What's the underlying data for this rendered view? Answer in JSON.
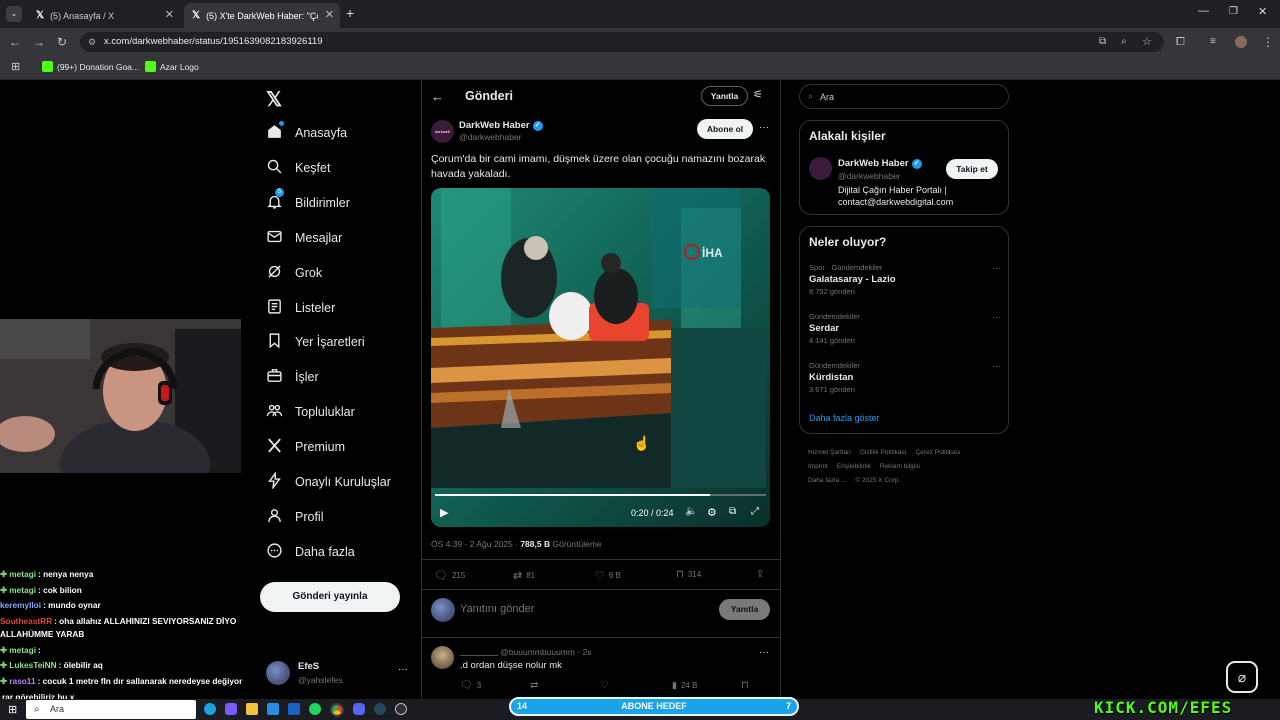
{
  "browser": {
    "tabs": [
      {
        "label": "(5) Anasayfa / X"
      },
      {
        "label": "(5) X'te DarkWeb Haber: \"Çorum"
      }
    ],
    "url": "x.com/darkwebhaber/status/1951639082183926119",
    "bookmarks": [
      {
        "label": "(99+) Donation Goa...",
        "color": "#53fc18"
      },
      {
        "label": "Azar Logo",
        "color": "#53fc18"
      }
    ]
  },
  "chat": [
    {
      "user": "metagi",
      "text": ": nenya nenya",
      "color": "#8be28b",
      "badge": true
    },
    {
      "user": "metagi",
      "text": ": cok bilion",
      "color": "#8be28b",
      "badge": true
    },
    {
      "user": "keremylloi",
      "text": ": mundo oynar",
      "color": "#88a6ff",
      "badge": false
    },
    {
      "user": "SoutheastRR",
      "text": ": oha allahız ALLAHINIZI SEVIYORSANIZ DİYO ALLAHÜMME YARAB",
      "color": "#e0443b",
      "badge": false
    },
    {
      "user": "metagi",
      "text": ":",
      "color": "#8be28b",
      "badge": true
    },
    {
      "user": "LukesTeiNN",
      "text": ": ölebilir aq",
      "color": "#8be28b",
      "badge": true
    },
    {
      "user": "raso11",
      "text": ": cocuk 1 metre fln dır sallanarak neredeyse değiyor",
      "color": "#c77dff",
      "badge": true
    },
    {
      "user": "",
      "text": "rar görebiliriz bu x",
      "color": "#ffffff",
      "badge": false
    }
  ],
  "nav": {
    "items": [
      {
        "label": "Anasayfa",
        "icon": "home-icon"
      },
      {
        "label": "Keşfet",
        "icon": "search-icon"
      },
      {
        "label": "Bildirimler",
        "icon": "bell-icon"
      },
      {
        "label": "Mesajlar",
        "icon": "mail-icon"
      },
      {
        "label": "Grok",
        "icon": "grok-icon"
      },
      {
        "label": "Listeler",
        "icon": "list-icon"
      },
      {
        "label": "Yer İşaretleri",
        "icon": "bookmark-icon"
      },
      {
        "label": "İşler",
        "icon": "briefcase-icon"
      },
      {
        "label": "Topluluklar",
        "icon": "communities-icon"
      },
      {
        "label": "Premium",
        "icon": "x-icon"
      },
      {
        "label": "Onaylı Kuruluşlar",
        "icon": "lightning-icon"
      },
      {
        "label": "Profil",
        "icon": "person-icon"
      },
      {
        "label": "Daha fazla",
        "icon": "more-circle-icon"
      }
    ],
    "post_button": "Gönderi yayınla",
    "notification_badge": "5",
    "account": {
      "name": "EfeS",
      "handle": "@yahslefes"
    }
  },
  "post_header": {
    "title": "Gönderi",
    "reply_button": "Yanıtla"
  },
  "tweet": {
    "author": "DarkWeb Haber",
    "handle": "@darkwebhaber",
    "follow_button": "Abone ol",
    "text": "Çorum'da bir cami imamı, düşmek üzere olan çocuğu namazını bozarak havada yakaladı.",
    "video": {
      "time": "0:20 / 0:24",
      "progress": 0.83,
      "watermark": "İHA"
    },
    "time": "ÖS 4:39 · 2 Ağu 2025 ·",
    "views": "788,5 B",
    "views_label": "Görüntüleme",
    "stats": {
      "replies": "215",
      "retweets": "81",
      "likes": "6 B",
      "bookmarks": "314"
    }
  },
  "reply_box": {
    "placeholder": "Yanıtını gönder",
    "button": "Yanıtla"
  },
  "reply": {
    "name": "________",
    "handle": "@buuummbuuumm · 2s",
    "text": ".d ordan düşse nolur mk",
    "stats": {
      "replies": "3",
      "views": "24 B"
    }
  },
  "sidebar": {
    "search_placeholder": "Ara",
    "related_title": "Alakalı kişiler",
    "related": {
      "name": "DarkWeb Haber",
      "handle": "@darkwebhaber",
      "bio_line1": "Dijital Çağın Haber Portalı |",
      "bio_line2": "contact@darkwebdigital.com",
      "follow": "Takip et"
    },
    "trends_title": "Neler oluyor?",
    "trends": [
      {
        "meta": "Spor · Gündemdekiler",
        "name": "Galatasaray - Lazio",
        "count": "8.752 gönderi"
      },
      {
        "meta": "Gündemdekiler",
        "name": "Serdar",
        "count": "4.141 gönderi"
      },
      {
        "meta": "Gündemdekiler",
        "name": "Kürdistan",
        "count": "3.671 gönderi"
      }
    ],
    "show_more": "Daha fazla göster",
    "footer_line1": [
      "Hizmet Şartları",
      "Gizlilik Politikası",
      "Çerez Politikası"
    ],
    "footer_line2": [
      "Imprint",
      "Erişilebilirlik",
      "Reklam bilgisi"
    ],
    "footer_line3": [
      "Daha fazla ...",
      "© 2025 X Corp."
    ]
  },
  "overlay": {
    "goal_left": "14",
    "goal_label": "ABONE HEDEF",
    "goal_right": "7",
    "brand": "KICK.COM/EFES"
  },
  "taskbar": {
    "search": "Ara"
  },
  "colors": {
    "accent": "#1d9bf0",
    "kick_green": "#53fc18",
    "goal_bar": "#1aa3e8"
  }
}
